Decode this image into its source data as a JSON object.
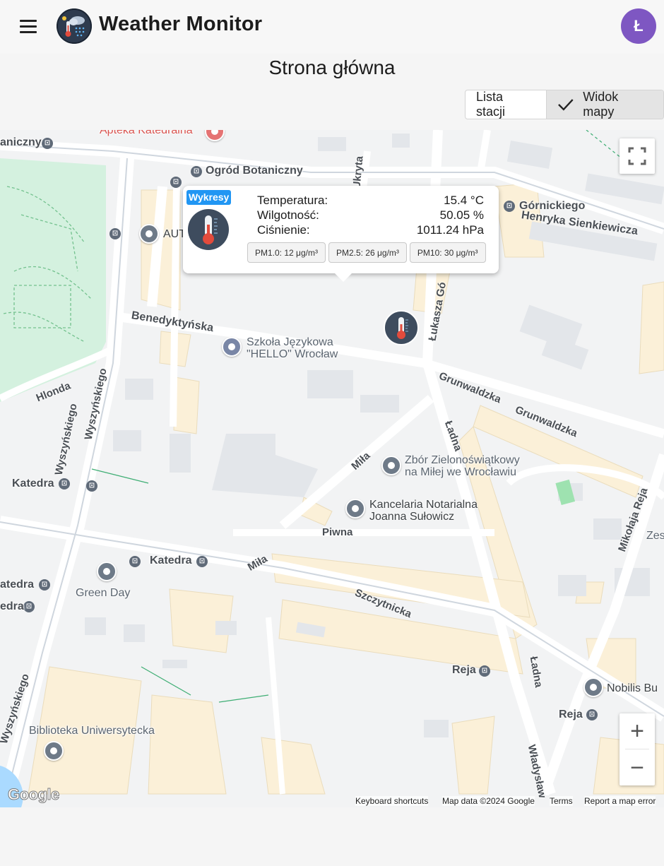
{
  "app": {
    "title": "Weather Monitor",
    "avatar_letter": "Ł",
    "accent_color": "#7e57c2",
    "menu_icon": "hamburger-menu-icon",
    "logo_icon": "weather-logo-icon"
  },
  "page": {
    "title": "Strona główna"
  },
  "view_toggle": {
    "list_label": "Lista stacji",
    "map_label": "Widok mapy",
    "selected": "Widok mapy"
  },
  "popup": {
    "charts_button": "Wykresy",
    "rows": [
      {
        "label": "Temperatura:",
        "value": "15.4 °C"
      },
      {
        "label": "Wilgotność:",
        "value": "50.05 %"
      },
      {
        "label": "Ciśnienie:",
        "value": "1011.24 hPa"
      }
    ],
    "chips": [
      "PM1.0: 12 μg/m³",
      "PM2.5: 26 μg/m³",
      "PM10: 30 μg/m³"
    ],
    "button_color": "#2196f3"
  },
  "map": {
    "places": {
      "apteka": "Apteka Katedralna",
      "ogrod": "Ogród Botaniczny",
      "gornickiego": "Górnickiego",
      "aut": "AUT",
      "szkola": "Szkoła Językowa\n\"HELLO\" Wrocław",
      "zbor": "Zbór Zielonoświątkowy\nna Miłej we Wrocławiu",
      "kancelaria": "Kancelaria Notarialna\nJoanna Sułowicz",
      "green_day": "Green Day",
      "biblioteka": "Biblioteka Uniwersytecka",
      "nobilis": "Nobilis Bu",
      "zes": "Zes",
      "katedra_stop1": "Katedra",
      "katedra_stop2": "Katedra",
      "katedra_stop3": "atedra",
      "katedra_stop4": "edra",
      "reja_stop1": "Reja",
      "reja_stop2": "Reja",
      "aniczny": "aniczny"
    },
    "streets": {
      "henryka": "Henryka Sienkiewicza",
      "benedyktynska": "Benedyktyńska",
      "grunwaldzka1": "Grunwaldzka",
      "grunwaldzka2": "Grunwaldzka",
      "lukasza": "Łukasza Gó",
      "ukryta": "Ukryta",
      "hlonda": "Hlonda",
      "wyszynskiego1": "Wyszyńskiego",
      "wyszynskiego2": "Wyszyńskiego",
      "wyszynskiego3": "Wyszyńskiego",
      "mila1": "Miła",
      "mila2": "Miła",
      "ladna1": "Ładna",
      "ladna2": "Ładna",
      "piwna": "Piwna",
      "szczytnicka": "Szczytnicka",
      "mikolaja": "Mikołaja Reja",
      "wladyslaw": "Władysław"
    },
    "controls": {
      "fullscreen_icon": "fullscreen-icon",
      "zoom_in": "+",
      "zoom_out": "−"
    },
    "attribution": {
      "logo": "Google",
      "shortcuts": "Keyboard shortcuts",
      "data": "Map data ©2024 Google",
      "terms": "Terms",
      "report": "Report a map error"
    }
  }
}
